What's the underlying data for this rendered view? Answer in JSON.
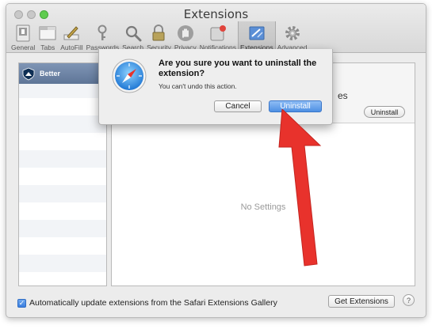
{
  "window": {
    "title": "Extensions"
  },
  "toolbar": {
    "items": [
      {
        "label": "General",
        "icon": "general-icon"
      },
      {
        "label": "Tabs",
        "icon": "tabs-icon"
      },
      {
        "label": "AutoFill",
        "icon": "autofill-icon"
      },
      {
        "label": "Passwords",
        "icon": "key-icon"
      },
      {
        "label": "Search",
        "icon": "search-icon"
      },
      {
        "label": "Security",
        "icon": "lock-icon"
      },
      {
        "label": "Privacy",
        "icon": "hand-icon"
      },
      {
        "label": "Notifications",
        "icon": "notifications-icon"
      },
      {
        "label": "Extensions",
        "icon": "extensions-icon"
      },
      {
        "label": "Advanced",
        "icon": "gear-icon"
      }
    ],
    "active": "Extensions"
  },
  "extensions_list": {
    "items": [
      {
        "name": "Better",
        "icon": "shield-icon"
      }
    ],
    "selected_index": 0
  },
  "detail": {
    "partial_title": "es",
    "uninstall_label": "Uninstall",
    "empty_text": "No Settings"
  },
  "bottom": {
    "auto_update_label": "Automatically update extensions from the Safari Extensions Gallery",
    "auto_update_checked": true,
    "checkbox_glyph": "✓",
    "get_extensions_label": "Get Extensions",
    "help_label": "?"
  },
  "dialog": {
    "title": "Are you sure you want to uninstall the extension?",
    "message": "You can't undo this action.",
    "cancel_label": "Cancel",
    "confirm_label": "Uninstall",
    "icon": "safari-compass-icon"
  },
  "colors": {
    "accent_blue": "#4d8fe3",
    "selection": "#6b82a4",
    "arrow_red": "#e8322c"
  }
}
